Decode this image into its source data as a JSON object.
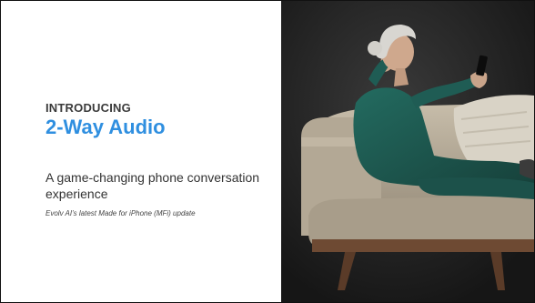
{
  "slide": {
    "eyebrow": "INTRODUCING",
    "headline": "2-Way Audio",
    "tagline": "A game-changing phone conversation experience",
    "subnote": "Evolv AI’s latest Made for iPhone (MFi) update"
  },
  "colors": {
    "headline": "#2f8fe0",
    "photo_background": "#1a1a1a",
    "sofa": "#b9ae9c",
    "dress": "#1f5a52"
  },
  "photo": {
    "subject": "woman-on-sofa-holding-phone"
  }
}
